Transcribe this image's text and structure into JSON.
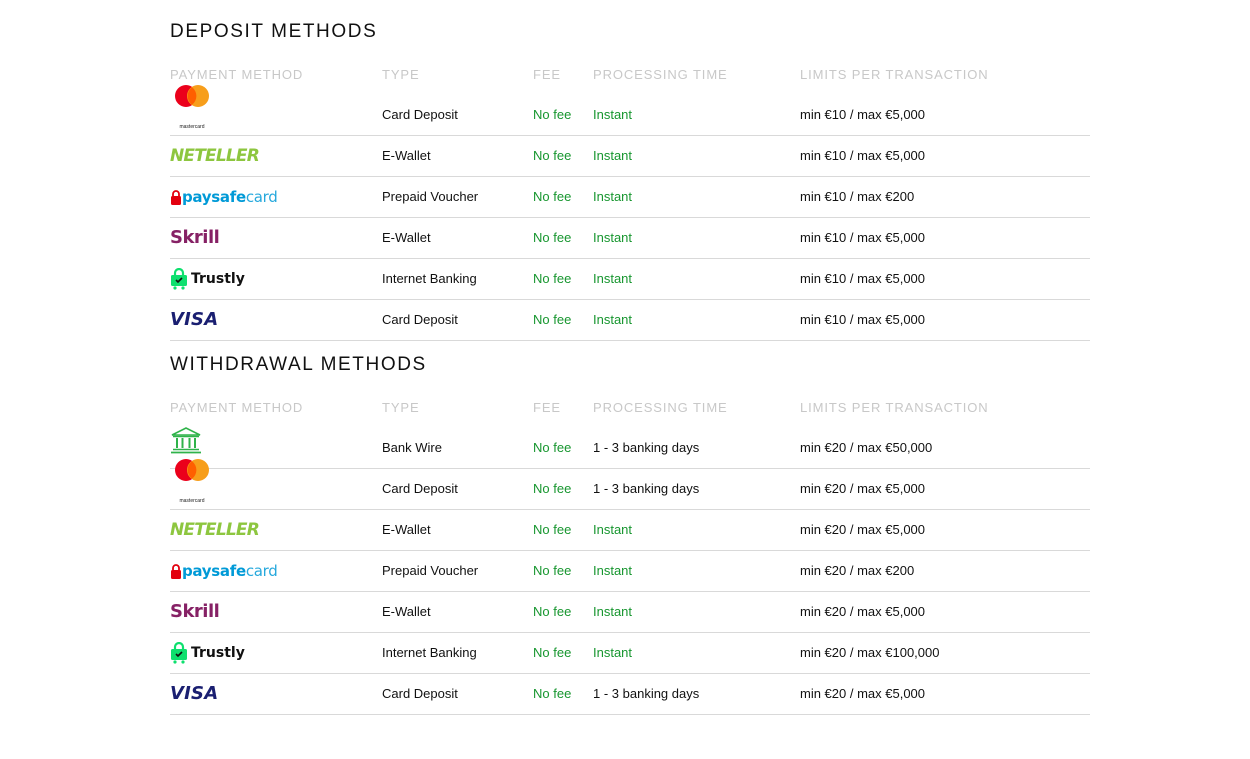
{
  "columns": {
    "payment_method": "PAYMENT METHOD",
    "type": "TYPE",
    "fee": "FEE",
    "processing_time": "PROCESSING TIME",
    "limits": "LIMITS PER TRANSACTION"
  },
  "deposit": {
    "title": "DEPOSIT METHODS",
    "rows": [
      {
        "logo": "mastercard",
        "logo_text": "mastercard",
        "type": "Card Deposit",
        "fee": "No fee",
        "time": "Instant",
        "limits": "min €10 / max €5,000"
      },
      {
        "logo": "neteller",
        "logo_text": "NETELLER",
        "type": "E-Wallet",
        "fee": "No fee",
        "time": "Instant",
        "limits": "min €10 / max €5,000"
      },
      {
        "logo": "paysafecard",
        "logo_text_a": "paysafe",
        "logo_text_b": "card",
        "type": "Prepaid Voucher",
        "fee": "No fee",
        "time": "Instant",
        "limits": "min €10 / max €200"
      },
      {
        "logo": "skrill",
        "logo_text": "Skrill",
        "type": "E-Wallet",
        "fee": "No fee",
        "time": "Instant",
        "limits": "min €10 / max €5,000"
      },
      {
        "logo": "trustly",
        "logo_text": "Trustly",
        "type": "Internet Banking",
        "fee": "No fee",
        "time": "Instant",
        "limits": "min €10 / max €5,000"
      },
      {
        "logo": "visa",
        "logo_text": "VISA",
        "type": "Card Deposit",
        "fee": "No fee",
        "time": "Instant",
        "limits": "min €10 / max €5,000"
      }
    ]
  },
  "withdrawal": {
    "title": "WITHDRAWAL METHODS",
    "rows": [
      {
        "logo": "bank",
        "type": "Bank Wire",
        "fee": "No fee",
        "time": "1 - 3 banking days",
        "limits": "min €20 / max €50,000"
      },
      {
        "logo": "mastercard",
        "logo_text": "mastercard",
        "type": "Card Deposit",
        "fee": "No fee",
        "time": "1 - 3 banking days",
        "limits": "min €20 / max €5,000"
      },
      {
        "logo": "neteller",
        "logo_text": "NETELLER",
        "type": "E-Wallet",
        "fee": "No fee",
        "time": "Instant",
        "limits": "min €20 / max €5,000"
      },
      {
        "logo": "paysafecard",
        "logo_text_a": "paysafe",
        "logo_text_b": "card",
        "type": "Prepaid Voucher",
        "fee": "No fee",
        "time": "Instant",
        "limits": "min €20 / max €200"
      },
      {
        "logo": "skrill",
        "logo_text": "Skrill",
        "type": "E-Wallet",
        "fee": "No fee",
        "time": "Instant",
        "limits": "min €20 / max €5,000"
      },
      {
        "logo": "trustly",
        "logo_text": "Trustly",
        "type": "Internet Banking",
        "fee": "No fee",
        "time": "Instant",
        "limits": "min €20 / max €100,000"
      },
      {
        "logo": "visa",
        "logo_text": "VISA",
        "type": "Card Deposit",
        "fee": "No fee",
        "time": "1 - 3 banking days",
        "limits": "min €20 / max €5,000"
      }
    ]
  },
  "colors": {
    "fee_green": "#17962f",
    "header_grey": "#c8c8c8",
    "divider": "#d9d9d9"
  }
}
